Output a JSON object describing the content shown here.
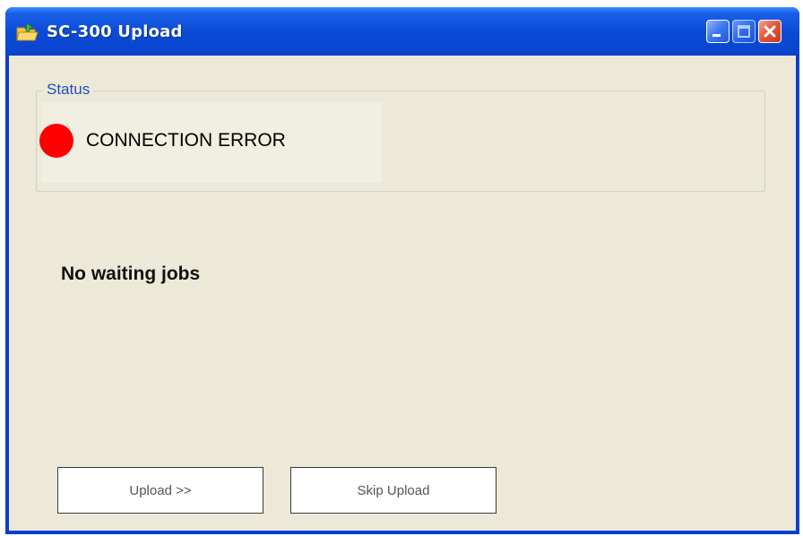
{
  "window": {
    "title": "SC-300 Upload",
    "icon": "folder-arrow-icon",
    "controls": [
      "minimize-icon",
      "maximize-icon",
      "close-icon"
    ]
  },
  "status_group": {
    "legend": "Status",
    "indicator_color": "#ff0000",
    "status_text": "CONNECTION ERROR"
  },
  "jobs": {
    "message": "No waiting jobs"
  },
  "buttons": {
    "upload_label": "Upload >>",
    "skip_label": "Skip Upload"
  },
  "colors": {
    "titlebar": "#0a46cf",
    "client_background": "#ece9d8",
    "legend_text": "#1f4fb8",
    "error_indicator": "#ff0000"
  }
}
